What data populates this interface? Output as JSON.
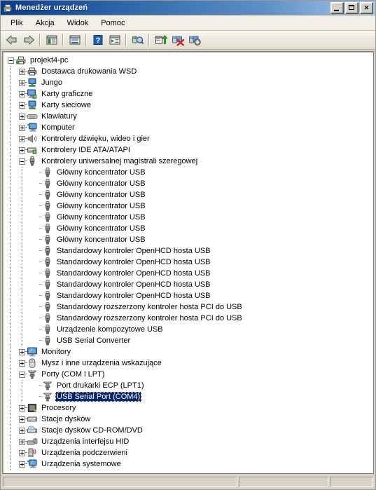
{
  "window": {
    "title": "Menedżer urządzeń",
    "icon": "device-manager-icon",
    "minimize_label": "",
    "maximize_label": "",
    "close_label": "✕"
  },
  "menubar": {
    "items": [
      {
        "label": "Plik",
        "name": "menu-plik"
      },
      {
        "label": "Akcja",
        "name": "menu-akcja"
      },
      {
        "label": "Widok",
        "name": "menu-widok"
      },
      {
        "label": "Pomoc",
        "name": "menu-pomoc"
      }
    ]
  },
  "toolbar": {
    "items": [
      {
        "name": "back-arrow-icon",
        "type": "button",
        "tooltip": "Wstecz"
      },
      {
        "name": "forward-arrow-icon",
        "type": "button",
        "tooltip": "Dalej"
      },
      {
        "name": "separator-1",
        "type": "separator"
      },
      {
        "name": "show-hide-console-tree-icon",
        "type": "button",
        "tooltip": "Pokaż/ukryj drzewo konsoli"
      },
      {
        "name": "separator-2",
        "type": "separator"
      },
      {
        "name": "properties-icon",
        "type": "button",
        "tooltip": "Właściwości"
      },
      {
        "name": "separator-3",
        "type": "separator"
      },
      {
        "name": "help-icon",
        "type": "button",
        "tooltip": "Pomoc"
      },
      {
        "name": "show-list-view-icon",
        "type": "button",
        "tooltip": "Widok listy"
      },
      {
        "name": "separator-4",
        "type": "separator"
      },
      {
        "name": "scan-for-hardware-changes-icon",
        "type": "button",
        "tooltip": "Skanuj w poszukiwaniu zmian sprzętu"
      },
      {
        "name": "separator-5",
        "type": "separator"
      },
      {
        "name": "update-driver-icon",
        "type": "button",
        "tooltip": "Aktualizuj sterownik"
      },
      {
        "name": "uninstall-device-icon",
        "type": "button",
        "tooltip": "Odinstaluj urządzenie"
      },
      {
        "name": "enable-device-icon",
        "type": "button",
        "tooltip": "Włącz urządzenie"
      }
    ]
  },
  "tree": {
    "rows": [
      {
        "label": "projekt4-pc",
        "level": 0,
        "state": "expanded",
        "icon": "computer-root-icon",
        "selected": false
      },
      {
        "label": "Dostawca drukowania WSD",
        "level": 1,
        "state": "collapsed",
        "icon": "printer-icon",
        "selected": false
      },
      {
        "label": "Jungo",
        "level": 1,
        "state": "collapsed",
        "icon": "network-adapter-icon",
        "selected": false
      },
      {
        "label": "Karty graficzne",
        "level": 1,
        "state": "collapsed",
        "icon": "display-adapter-icon",
        "selected": false
      },
      {
        "label": "Karty sieciowe",
        "level": 1,
        "state": "collapsed",
        "icon": "network-adapter-icon",
        "selected": false
      },
      {
        "label": "Klawiatury",
        "level": 1,
        "state": "collapsed",
        "icon": "keyboard-icon",
        "selected": false
      },
      {
        "label": "Komputer",
        "level": 1,
        "state": "collapsed",
        "icon": "computer-icon",
        "selected": false
      },
      {
        "label": "Kontrolery dźwięku, wideo i gier",
        "level": 1,
        "state": "collapsed",
        "icon": "sound-icon",
        "selected": false
      },
      {
        "label": "Kontrolery IDE ATA/ATAPI",
        "level": 1,
        "state": "collapsed",
        "icon": "ide-controller-icon",
        "selected": false
      },
      {
        "label": "Kontrolery uniwersalnej magistrali szeregowej",
        "level": 1,
        "state": "expanded",
        "icon": "usb-icon",
        "selected": false
      },
      {
        "label": "Główny koncentrator USB",
        "level": 2,
        "state": "leaf",
        "icon": "usb-icon",
        "selected": false
      },
      {
        "label": "Główny koncentrator USB",
        "level": 2,
        "state": "leaf",
        "icon": "usb-icon",
        "selected": false
      },
      {
        "label": "Główny koncentrator USB",
        "level": 2,
        "state": "leaf",
        "icon": "usb-icon",
        "selected": false
      },
      {
        "label": "Główny koncentrator USB",
        "level": 2,
        "state": "leaf",
        "icon": "usb-icon",
        "selected": false
      },
      {
        "label": "Główny koncentrator USB",
        "level": 2,
        "state": "leaf",
        "icon": "usb-icon",
        "selected": false
      },
      {
        "label": "Główny koncentrator USB",
        "level": 2,
        "state": "leaf",
        "icon": "usb-icon",
        "selected": false
      },
      {
        "label": "Główny koncentrator USB",
        "level": 2,
        "state": "leaf",
        "icon": "usb-icon",
        "selected": false
      },
      {
        "label": "Standardowy kontroler OpenHCD hosta USB",
        "level": 2,
        "state": "leaf",
        "icon": "usb-icon",
        "selected": false
      },
      {
        "label": "Standardowy kontroler OpenHCD hosta USB",
        "level": 2,
        "state": "leaf",
        "icon": "usb-icon",
        "selected": false
      },
      {
        "label": "Standardowy kontroler OpenHCD hosta USB",
        "level": 2,
        "state": "leaf",
        "icon": "usb-icon",
        "selected": false
      },
      {
        "label": "Standardowy kontroler OpenHCD hosta USB",
        "level": 2,
        "state": "leaf",
        "icon": "usb-icon",
        "selected": false
      },
      {
        "label": "Standardowy kontroler OpenHCD hosta USB",
        "level": 2,
        "state": "leaf",
        "icon": "usb-icon",
        "selected": false
      },
      {
        "label": "Standardowy rozszerzony kontroler hosta PCI do USB",
        "level": 2,
        "state": "leaf",
        "icon": "usb-icon",
        "selected": false
      },
      {
        "label": "Standardowy rozszerzony kontroler hosta PCI do USB",
        "level": 2,
        "state": "leaf",
        "icon": "usb-icon",
        "selected": false
      },
      {
        "label": "Urządzenie kompozytowe USB",
        "level": 2,
        "state": "leaf",
        "icon": "usb-icon",
        "selected": false
      },
      {
        "label": "USB Serial Converter",
        "level": 2,
        "state": "leaf",
        "icon": "usb-icon",
        "selected": false
      },
      {
        "label": "Monitory",
        "level": 1,
        "state": "collapsed",
        "icon": "monitor-icon",
        "selected": false
      },
      {
        "label": "Mysz i inne urządzenia wskazujące",
        "level": 1,
        "state": "collapsed",
        "icon": "mouse-icon",
        "selected": false
      },
      {
        "label": "Porty (COM i LPT)",
        "level": 1,
        "state": "expanded",
        "icon": "port-icon",
        "selected": false
      },
      {
        "label": "Port drukarki ECP (LPT1)",
        "level": 2,
        "state": "leaf",
        "icon": "port-icon",
        "selected": false
      },
      {
        "label": "USB Serial Port (COM4)",
        "level": 2,
        "state": "leaf",
        "icon": "port-icon",
        "selected": true
      },
      {
        "label": "Procesory",
        "level": 1,
        "state": "collapsed",
        "icon": "processor-icon",
        "selected": false
      },
      {
        "label": "Stacje dysków",
        "level": 1,
        "state": "collapsed",
        "icon": "disk-drive-icon",
        "selected": false
      },
      {
        "label": "Stacje dysków CD-ROM/DVD",
        "level": 1,
        "state": "collapsed",
        "icon": "cdrom-icon",
        "selected": false
      },
      {
        "label": "Urządzenia interfejsu HID",
        "level": 1,
        "state": "collapsed",
        "icon": "hid-icon",
        "selected": false
      },
      {
        "label": "Urządzenia podczerwieni",
        "level": 1,
        "state": "collapsed",
        "icon": "infrared-icon",
        "selected": false
      },
      {
        "label": "Urządzenia systemowe",
        "level": 1,
        "state": "collapsed",
        "icon": "system-device-icon",
        "selected": false
      }
    ]
  },
  "statusbar": {
    "pane1": "",
    "pane2": "",
    "pane3": ""
  },
  "colors": {
    "selection": "#0a246a",
    "selection_text": "#ffffff",
    "window_face": "#d6d2c7",
    "tree_background": "#ffffff",
    "title_gradient_start": "#0a3c8e",
    "title_gradient_end": "#a7c6e6"
  }
}
